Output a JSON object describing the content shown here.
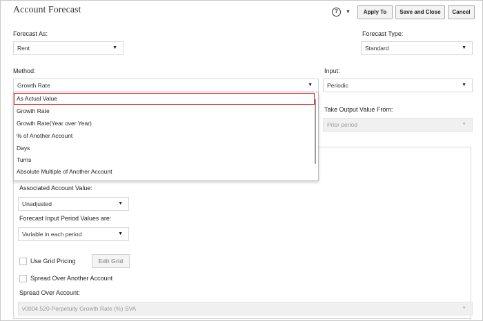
{
  "header": {
    "title": "Account Forecast",
    "help_icon": "help-circle-icon",
    "help_glyph": "?",
    "caret": "▼",
    "apply_label": "Apply To",
    "save_close_label": "Save and Close",
    "cancel_label": "Cancel"
  },
  "forecast_as": {
    "label": "Forecast As:",
    "value": "Rent"
  },
  "forecast_type": {
    "label": "Forecast Type:",
    "value": "Standard"
  },
  "method": {
    "label": "Method:",
    "value": "Growth Rate",
    "options": [
      "As Actual Value",
      "Growth Rate",
      "Growth Rate(Year over Year)",
      "% of Another Account",
      "Days",
      "Turns",
      "Absolute Multiple of Another Account"
    ],
    "highlighted_index": 0
  },
  "input": {
    "label": "Input:",
    "value": "Periodic"
  },
  "take_output": {
    "label": "Take Output Value From:",
    "value": "Prior period"
  },
  "associated": {
    "label": "Associated Account Value:",
    "value": "Unadjusted"
  },
  "input_period": {
    "label": "Forecast Input Period Values are:",
    "value": "Variable in each period"
  },
  "grid_pricing": {
    "label": "Use Grid Pricing",
    "edit_grid": "Edit Grid",
    "checked": false
  },
  "spread_over_another": {
    "label": "Spread Over Another Account",
    "checked": false
  },
  "spread_over_account": {
    "label": "Spread Over Account:",
    "value": "v0004.520-Perpetuity Growth Rate (%) SVA"
  },
  "colors": {
    "selection_border": "#d9262a",
    "disabled_bg": "#f0f0f0"
  }
}
